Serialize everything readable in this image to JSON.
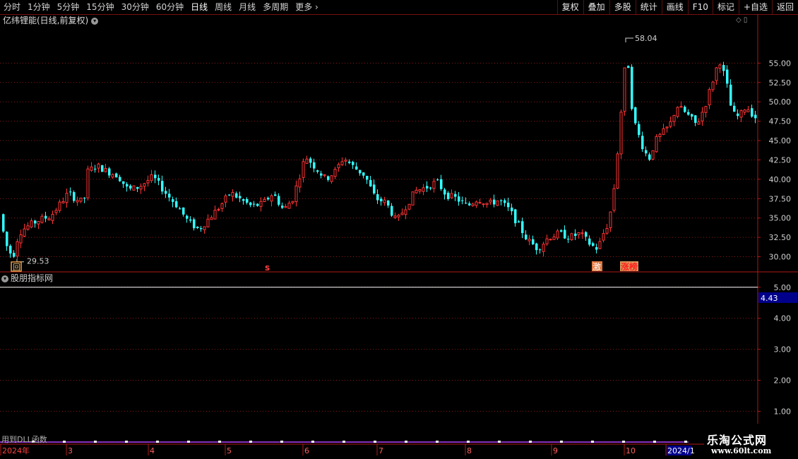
{
  "toolbar": {
    "periods": [
      "分时",
      "1分钟",
      "5分钟",
      "15分钟",
      "30分钟",
      "60分钟",
      "日线",
      "周线",
      "月线",
      "多周期",
      "更多"
    ],
    "active_period": "日线",
    "tools": [
      "复权",
      "叠加",
      "多股",
      "统计",
      "画线",
      "F10",
      "标记",
      "+自选",
      "返回"
    ]
  },
  "stock_title": "亿纬锂能(日线,前复权)",
  "indicator_title": "股朋指标网",
  "bottom_note": "用到DLL函数",
  "logo": {
    "main": "乐淘公式网",
    "url": "www.60lt.com"
  },
  "markers": {
    "low": "29.53",
    "high": "58.04",
    "box_hui": "回",
    "s_mark": "s",
    "box_ji": "激",
    "box_zhangbang": "涨榜"
  },
  "colors": {
    "up": "#ff3333",
    "down": "#33ffff",
    "grid": "#8b1a1a",
    "axis": "#b01818",
    "indicator_line": "#ffffff",
    "value_box": "#00008b"
  },
  "chart_data": {
    "type": "candlestick",
    "price_axis": {
      "ticks": [
        30.0,
        32.5,
        35.0,
        37.5,
        40.0,
        42.5,
        45.0,
        47.5,
        50.0,
        52.5,
        55.0
      ],
      "range": [
        28.5,
        59.5
      ]
    },
    "indicator_axis": {
      "ticks": [
        1.0,
        2.0,
        3.0,
        4.0,
        5.0
      ],
      "range": [
        0.6,
        5.2
      ],
      "current_value": "4.43",
      "line_value": 5.0
    },
    "time_labels": [
      "2024年",
      "3",
      "4",
      "5",
      "6",
      "7",
      "8",
      "9",
      "10",
      "2024/1"
    ],
    "low": 29.53,
    "high": 58.04
  }
}
